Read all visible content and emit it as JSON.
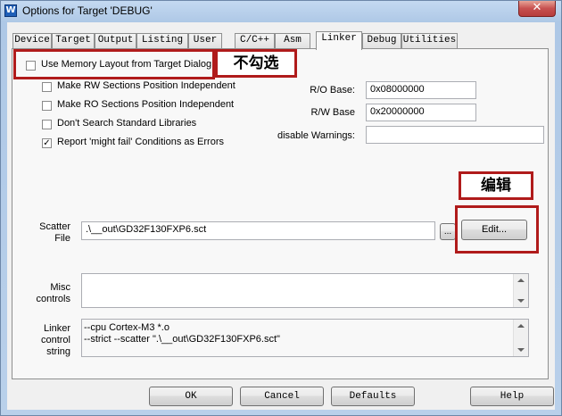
{
  "window": {
    "title": "Options for Target 'DEBUG'",
    "close_symbol": "✕",
    "icon_letter": "W"
  },
  "tabs": [
    {
      "label": "Device",
      "active": false
    },
    {
      "label": "Target",
      "active": false
    },
    {
      "label": "Output",
      "active": false
    },
    {
      "label": "Listing",
      "active": false
    },
    {
      "label": "User",
      "active": false
    },
    {
      "label": "C/C++",
      "active": false
    },
    {
      "label": "Asm",
      "active": false
    },
    {
      "label": "Linker",
      "active": true
    },
    {
      "label": "Debug",
      "active": false
    },
    {
      "label": "Utilities",
      "active": false
    }
  ],
  "linker": {
    "use_memory_layout": {
      "label": "Use Memory Layout from Target Dialog",
      "checked": false
    },
    "options": [
      {
        "label": "Make RW Sections Position Independent",
        "checked": false
      },
      {
        "label": "Make RO Sections Position Independent",
        "checked": false
      },
      {
        "label": "Don't Search Standard Libraries",
        "checked": false
      },
      {
        "label": "Report 'might fail' Conditions as Errors",
        "checked": true
      }
    ],
    "ro_base": {
      "label": "R/O Base:",
      "value": "0x08000000"
    },
    "rw_base": {
      "label": "R/W Base",
      "value": "0x20000000"
    },
    "disable_warnings": {
      "label": "disable Warnings:",
      "value": ""
    },
    "scatter_file": {
      "label_line1": "Scatter",
      "label_line2": "File",
      "value": ".\\__out\\GD32F130FXP6.sct",
      "browse_label": "...",
      "edit_label": "Edit..."
    },
    "misc_controls": {
      "label_line1": "Misc",
      "label_line2": "controls",
      "value": ""
    },
    "linker_control_string": {
      "label_line1": "Linker",
      "label_line2": "control",
      "label_line3": "string",
      "line1": "--cpu Cortex-M3 *.o",
      "line2": "--strict --scatter \".\\__out\\GD32F130FXP6.sct\""
    }
  },
  "annotations": {
    "uncheck_note": "不勾选",
    "edit_note": "编辑"
  },
  "buttons": {
    "ok": "OK",
    "cancel": "Cancel",
    "defaults": "Defaults",
    "help": "Help"
  },
  "colors": {
    "annotation_red": "#b01b1b"
  }
}
